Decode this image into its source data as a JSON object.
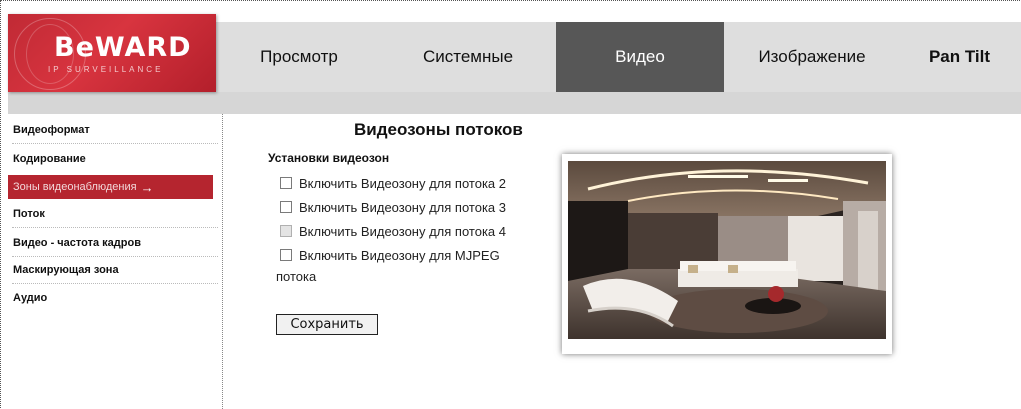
{
  "logo": {
    "brand": "BeWARD",
    "tagline": "IP SURVEILLANCE"
  },
  "nav": {
    "tabs": [
      {
        "label": "Просмотр"
      },
      {
        "label": "Системные"
      },
      {
        "label": "Видео"
      },
      {
        "label": "Изображение"
      },
      {
        "label": "Pan Tilt"
      }
    ],
    "active_tab": "Видео"
  },
  "sidebar": {
    "items": [
      {
        "label": "Видеоформат"
      },
      {
        "label": "Кодирование"
      },
      {
        "label": "Зоны видеонаблюдения"
      },
      {
        "label": "Поток"
      },
      {
        "label": "Видео - частота кадров"
      },
      {
        "label": "Маскирующая зона"
      },
      {
        "label": "Аудио"
      }
    ],
    "active_item": "Зоны видеонаблюдения",
    "arrow": "→"
  },
  "main": {
    "title": "Видеозоны потоков",
    "section_title": "Установки видеозон",
    "options": [
      {
        "label": "Включить Видеозону для потока 2",
        "checked": false,
        "disabled": false
      },
      {
        "label": "Включить Видеозону для потока 3",
        "checked": false,
        "disabled": false
      },
      {
        "label": "Включить Видеозону для потока 4",
        "checked": false,
        "disabled": true
      },
      {
        "label_line1": "Включить Видеозону для MJPEG",
        "label_line2": "потока",
        "checked": false,
        "disabled": false
      }
    ],
    "save_label": "Сохранить"
  },
  "colors": {
    "brand_red": "#c02a35",
    "active_tab_bg": "#575757",
    "sidebar_active_bg": "#b5252f",
    "header_bg": "#dedede"
  }
}
